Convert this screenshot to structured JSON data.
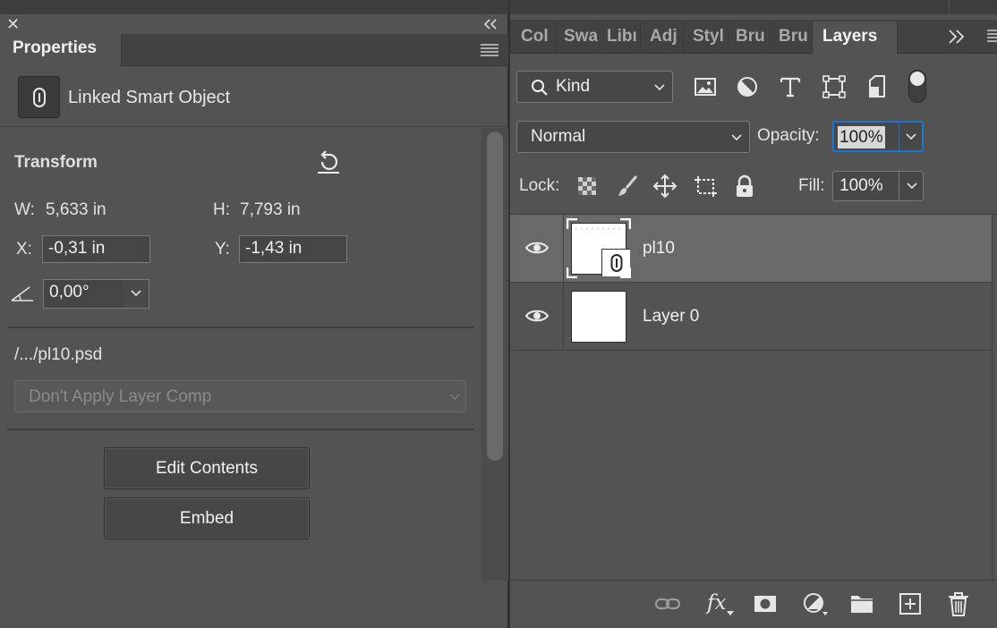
{
  "properties": {
    "tab_label": "Properties",
    "object_type": "Linked Smart Object",
    "transform": {
      "title": "Transform",
      "w_label": "W:",
      "w_value": "5,633 in",
      "h_label": "H:",
      "h_value": "7,793 in",
      "x_label": "X:",
      "x_value": "-0,31 in",
      "y_label": "Y:",
      "y_value": "-1,43 in",
      "angle_value": "0,00°"
    },
    "file_path": "/.../pl10.psd",
    "layer_comp_placeholder": "Don't Apply Layer Comp",
    "edit_contents_label": "Edit Contents",
    "embed_label": "Embed"
  },
  "layers_panel": {
    "tabs": [
      "Col",
      "Swa",
      "Libı",
      "Adj",
      "Styl",
      "Bru",
      "Bru",
      "Layers"
    ],
    "active_tab": "Layers",
    "filter_kind": "Kind",
    "blend_mode": "Normal",
    "opacity_label": "Opacity:",
    "opacity_value": "100%",
    "lock_label": "Lock:",
    "fill_label": "Fill:",
    "fill_value": "100%",
    "layers": [
      {
        "name": "pl10",
        "visible": true,
        "selected": true,
        "linked_smart_object": true
      },
      {
        "name": "Layer 0",
        "visible": true,
        "selected": false,
        "linked_smart_object": false
      }
    ],
    "bottom_icons": [
      "link-layers-icon",
      "fx-icon",
      "add-mask-icon",
      "adjustment-layer-icon",
      "new-group-icon",
      "new-layer-icon",
      "delete-layer-icon"
    ],
    "fx_label": "fx"
  },
  "colors": {
    "panel_bg": "#535353",
    "tab_bar_bg": "#424242",
    "selected_layer_bg": "#696969",
    "focus_blue": "#1a76d2"
  }
}
